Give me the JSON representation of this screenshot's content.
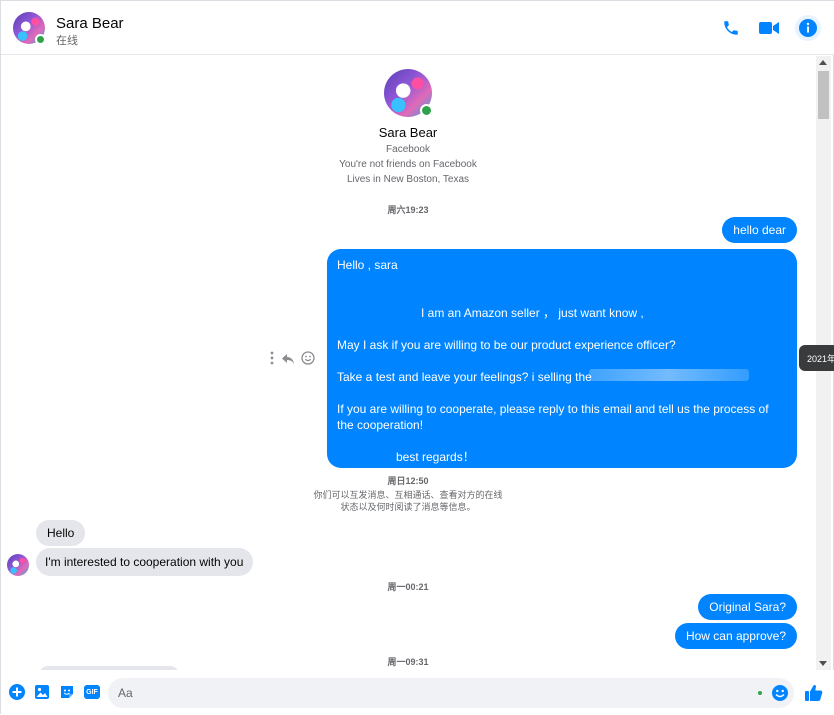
{
  "header": {
    "name": "Sara Bear",
    "status": "在线"
  },
  "profile": {
    "name": "Sara Bear",
    "line1": "Facebook",
    "line2": "You're not friends on Facebook",
    "line3": "Lives in New Boston, Texas"
  },
  "messages": {
    "ts1": "周六19:23",
    "m1": "hello dear",
    "long": {
      "l1": "Hello , sara",
      "l2": "I am an Amazon seller  ，  just want know ,",
      "l3": "May I ask if you are willing to be our product experience officer?",
      "l4": "Take a test and leave your feelings? i selling the",
      "l5": "If you are willing to cooperate, please reply to this email and tell us the process of",
      "l6": "the cooperation!",
      "l7": "best regards！"
    },
    "tooltip": "2021年",
    "ts2": "周日12:50",
    "notice1": "你们可以互发消息、互相通话、查看对方的在线",
    "notice2": "状态以及何时阅读了消息等信息。",
    "in1": "Hello",
    "in2": "I'm interested to cooperation with you",
    "ts3": "周一00:21",
    "m2": "Original Sara?",
    "m3": "How can approve?",
    "ts4": "周一09:31"
  },
  "composer": {
    "placeholder": "Aa",
    "gif_label": "GIF"
  },
  "colors": {
    "accent": "#0084ff",
    "online": "#31a24c",
    "incoming": "#e4e6eb"
  },
  "icons": [
    "phone-icon",
    "video-icon",
    "info-icon",
    "plus-icon",
    "image-icon",
    "sticker-icon",
    "gif-icon",
    "emoji-icon",
    "like-icon",
    "more-icon",
    "reply-icon",
    "react-icon"
  ]
}
